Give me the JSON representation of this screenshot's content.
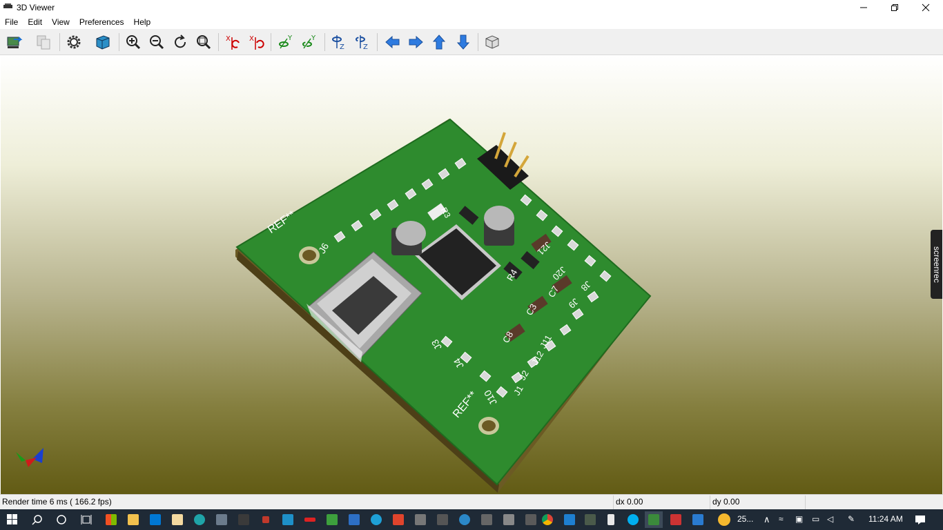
{
  "window": {
    "title": "3D Viewer",
    "minimize_icon": "minimize-icon",
    "maximize_icon": "restore-icon",
    "close_icon": "close-icon"
  },
  "menu": [
    "File",
    "Edit",
    "View",
    "Preferences",
    "Help"
  ],
  "toolbar": {
    "buttons": [
      "reload-board-icon",
      "copy-image-icon",
      "settings-icon",
      "raytracing-cube-icon",
      "zoom-in-icon",
      "zoom-out-icon",
      "redraw-icon",
      "zoom-fit-icon",
      "rotate-x-cw-icon",
      "rotate-x-ccw-icon",
      "rotate-y-cw-icon",
      "rotate-y-ccw-icon",
      "rotate-z-cw-icon",
      "rotate-z-ccw-icon",
      "pan-left-icon",
      "pan-right-icon",
      "pan-up-icon",
      "pan-down-icon",
      "orthographic-toggle-icon"
    ]
  },
  "colors": {
    "pcb_green": "#2e8b2e",
    "viewport_top": "#ffffff",
    "viewport_bottom": "#625b14",
    "arrow_blue": "#2e7be0",
    "taskbar": "#1f2a36"
  },
  "board": {
    "silkscreen": [
      "REF**",
      "REF**",
      "J6",
      "J10",
      "J3",
      "J4",
      "J1",
      "J2",
      "J20",
      "J21",
      "J8",
      "J9",
      "C3",
      "C7",
      "C8",
      "R4",
      "R3",
      "J11",
      "J12"
    ]
  },
  "overlay": {
    "screenrec_label": "screenrec"
  },
  "status": {
    "render_time": "Render time 6 ms ( 166.2 fps)",
    "dx": "dx 0.00",
    "dy": "dy 0.00"
  },
  "taskbar": {
    "weather": "25...",
    "time": "11:24 AM",
    "icons": [
      "start-icon",
      "search-icon",
      "cortana-icon",
      "task-view-icon",
      "store-icon",
      "file-explorer-icon",
      "mail-icon",
      "notepad-icon",
      "edge-icon",
      "ie-icon",
      "notion-icon",
      "app-icon",
      "app-icon",
      "app-icon",
      "app-icon",
      "app-icon",
      "app-icon",
      "app-icon",
      "app-icon",
      "app-icon",
      "app-icon",
      "chrome-icon",
      "app-icon",
      "app-icon",
      "app-icon",
      "skype-icon",
      "kicad-icon",
      "app-icon",
      "app-icon"
    ]
  }
}
